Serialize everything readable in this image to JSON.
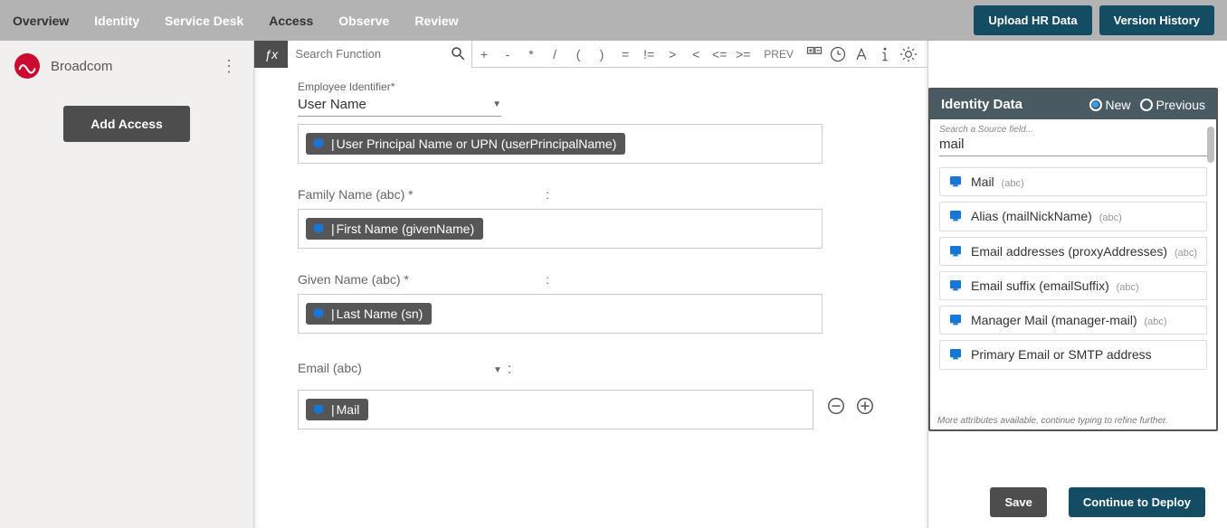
{
  "nav": {
    "overview": "Overview",
    "identity": "Identity",
    "servicedesk": "Service Desk",
    "access": "Access",
    "observe": "Observe",
    "review": "Review",
    "upload": "Upload HR Data",
    "version": "Version History"
  },
  "sidebar": {
    "brand": "Broadcom",
    "add_access": "Add Access"
  },
  "toolbar": {
    "search_placeholder": "Search Function",
    "ops": {
      "plus": "+",
      "minus": "-",
      "star": "*",
      "slash": "/",
      "lp": "(",
      "rp": ")",
      "eq": "=",
      "neq": "!=",
      "gt": ">",
      "lt": "<",
      "lte": "<=",
      "gte": ">="
    },
    "prev": "PREV"
  },
  "form": {
    "emp_id_label": "Employee Identifier*",
    "emp_id_value": "User Name",
    "emp_id_pill": "User Principal Name or UPN (userPrincipalName)",
    "family_label": "Family Name (abc) *",
    "family_pill": "First Name (givenName)",
    "given_label": "Given Name (abc) *",
    "given_pill": "Last Name (sn)",
    "email_label": "Email (abc)",
    "email_pill": "Mail",
    "colon": ":"
  },
  "panel": {
    "title": "Identity Data",
    "radio_new": "New",
    "radio_prev": "Previous",
    "search_label": "Search a Source field...",
    "search_value": "mail",
    "items": [
      {
        "name": "Mail",
        "type": "(abc)"
      },
      {
        "name": "Alias (mailNickName)",
        "type": "(abc)"
      },
      {
        "name": "Email addresses (proxyAddresses)",
        "type": "(abc)"
      },
      {
        "name": "Email suffix (emailSuffix)",
        "type": "(abc)"
      },
      {
        "name": "Manager Mail (manager-mail)",
        "type": "(abc)"
      },
      {
        "name": "Primary Email or SMTP address",
        "type": ""
      }
    ],
    "footer": "More attributes available, continue typing to refine further."
  },
  "footer": {
    "save": "Save",
    "deploy": "Continue to Deploy"
  }
}
